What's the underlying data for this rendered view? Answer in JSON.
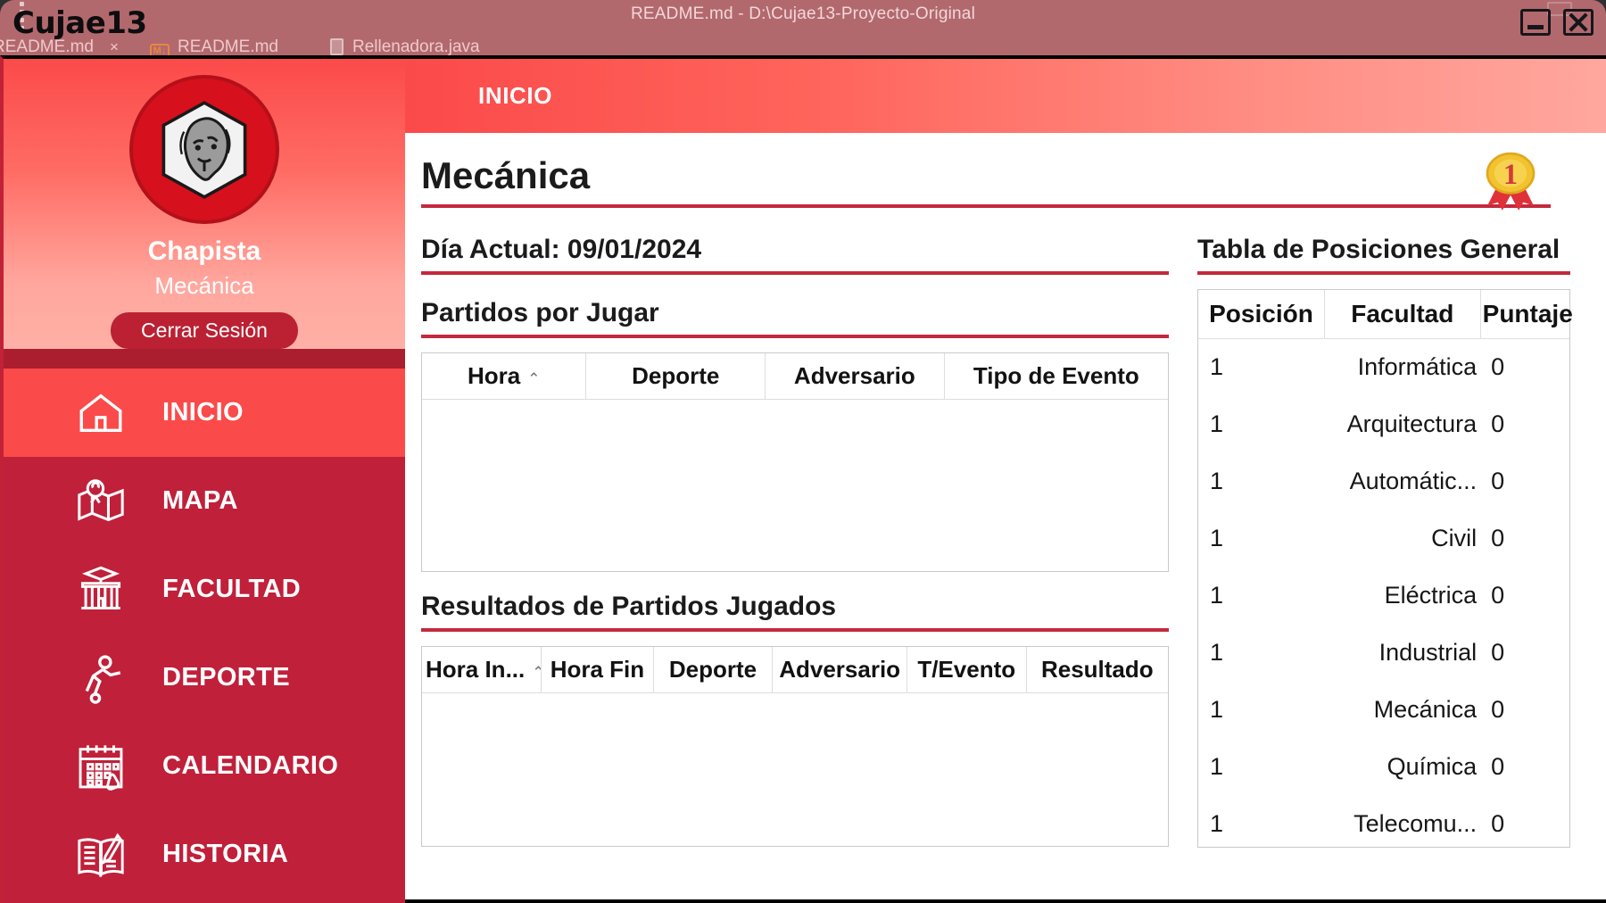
{
  "background_window": {
    "title": "README.md - D:\\Cujae13-Proyecto-Original",
    "tabs": [
      {
        "label": "README.md",
        "close": "×",
        "icon": "markdown-icon"
      },
      {
        "label": "README.md",
        "icon": "markdown-icon"
      },
      {
        "label": "Rellenadora.java",
        "icon": "java-file-icon"
      }
    ]
  },
  "window": {
    "app_title": "Cujae13",
    "minimize_label": "—",
    "close_label": "✕"
  },
  "sidebar": {
    "avatar_icon": "lion-crest-icon",
    "user_name": "Chapista",
    "user_faculty": "Mecánica",
    "logout_label": "Cerrar Sesión",
    "items": [
      {
        "label": "INICIO",
        "icon": "home-icon",
        "active": true
      },
      {
        "label": "MAPA",
        "icon": "map-pin-icon",
        "active": false
      },
      {
        "label": "FACULTAD",
        "icon": "school-icon",
        "active": false
      },
      {
        "label": "DEPORTE",
        "icon": "soccer-player-icon",
        "active": false
      },
      {
        "label": "CALENDARIO",
        "icon": "calendar-icon",
        "active": false
      },
      {
        "label": "HISTORIA",
        "icon": "open-book-icon",
        "active": false
      }
    ]
  },
  "header": {
    "breadcrumb": "INICIO"
  },
  "main": {
    "page_title": "Mecánica",
    "medal_rank": "1",
    "current_day": "Día Actual: 09/01/2024",
    "upcoming": {
      "heading": "Partidos por Jugar",
      "columns": [
        "Hora",
        "Deporte",
        "Adversario",
        "Tipo de Evento"
      ],
      "sorted_column": "Hora",
      "sort_caret": "⌃",
      "rows": []
    },
    "results": {
      "heading": "Resultados de Partidos Jugados",
      "columns": [
        "Hora In...",
        "Hora Fin",
        "Deporte",
        "Adversario",
        "T/Evento",
        "Resultado"
      ],
      "sorted_column": "Hora In...",
      "sort_caret": "⌃",
      "rows": []
    }
  },
  "standings": {
    "heading": "Tabla de Posiciones General",
    "columns": [
      "Posición",
      "Facultad",
      "Puntaje"
    ],
    "rows": [
      {
        "posicion": "1",
        "facultad": "Informática",
        "puntaje": "0"
      },
      {
        "posicion": "1",
        "facultad": "Arquitectura",
        "puntaje": "0"
      },
      {
        "posicion": "1",
        "facultad": "Automátic...",
        "puntaje": "0"
      },
      {
        "posicion": "1",
        "facultad": "Civil",
        "puntaje": "0"
      },
      {
        "posicion": "1",
        "facultad": "Eléctrica",
        "puntaje": "0"
      },
      {
        "posicion": "1",
        "facultad": "Industrial",
        "puntaje": "0"
      },
      {
        "posicion": "1",
        "facultad": "Mecánica",
        "puntaje": "0"
      },
      {
        "posicion": "1",
        "facultad": "Química",
        "puntaje": "0"
      },
      {
        "posicion": "1",
        "facultad": "Telecomu...",
        "puntaje": "0"
      }
    ]
  },
  "colors": {
    "brand_red": "#c0203a",
    "accent_red": "#fb4a4a",
    "rule_red": "#c42a3c",
    "logo_red": "#d6101c",
    "medal_gold": "#f2c230"
  }
}
